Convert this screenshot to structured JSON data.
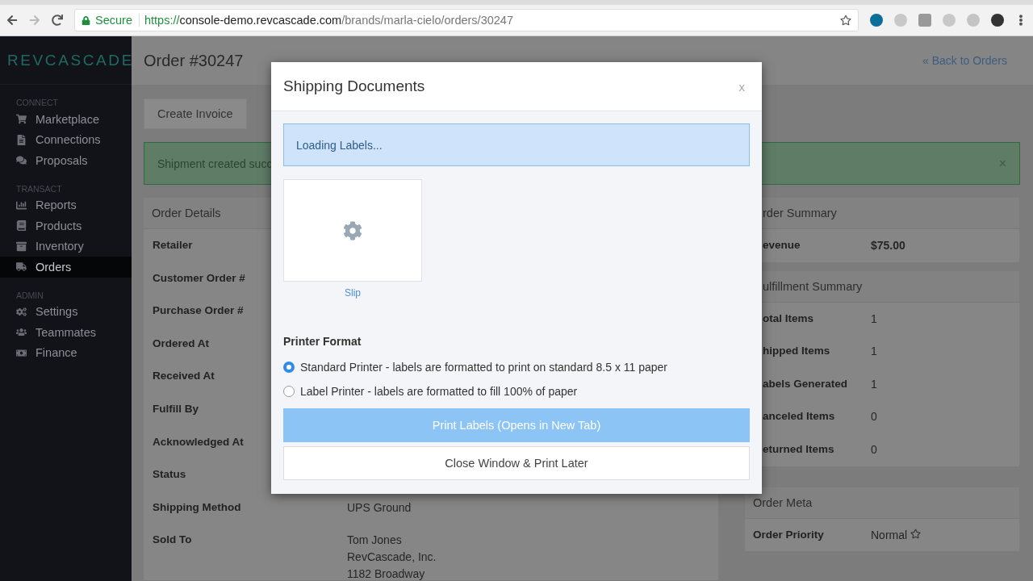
{
  "browser": {
    "secure_label": "Secure",
    "url_scheme": "https://",
    "url_host": "console-demo.revcascade.com",
    "url_path": "/brands/marla-cielo/orders/30247"
  },
  "sidebar": {
    "logo": "REVCASCADE",
    "sections": [
      {
        "title": "CONNECT",
        "items": [
          {
            "label": "Marketplace",
            "selected": false
          },
          {
            "label": "Connections",
            "selected": false
          },
          {
            "label": "Proposals",
            "selected": false
          }
        ]
      },
      {
        "title": "TRANSACT",
        "items": [
          {
            "label": "Reports",
            "selected": false
          },
          {
            "label": "Products",
            "selected": false
          },
          {
            "label": "Inventory",
            "selected": false
          },
          {
            "label": "Orders",
            "selected": true
          }
        ]
      },
      {
        "title": "ADMIN",
        "items": [
          {
            "label": "Settings",
            "selected": false
          },
          {
            "label": "Teammates",
            "selected": false
          },
          {
            "label": "Finance",
            "selected": false
          }
        ]
      }
    ]
  },
  "page": {
    "title": "Order #30247",
    "back_link": "« Back to Orders",
    "actions": [
      "Create Invoice"
    ],
    "alert": {
      "text": "Shipment created succ",
      "close": "×"
    },
    "order_details": {
      "title": "Order Details",
      "rows": [
        {
          "label": "Retailer"
        },
        {
          "label": "Customer Order #"
        },
        {
          "label": "Purchase Order #"
        },
        {
          "label": "Ordered At"
        },
        {
          "label": "Received At"
        },
        {
          "label": "Fulfill By"
        },
        {
          "label": "Acknowledged At"
        },
        {
          "label": "Status"
        },
        {
          "label": "Shipping Method",
          "value": [
            "UPS Ground"
          ]
        },
        {
          "label": "Sold To",
          "value": [
            "Tom Jones",
            "RevCascade, Inc.",
            "1182 Broadway"
          ]
        }
      ]
    },
    "summary_cards": [
      {
        "title": "rder Summary",
        "rows": [
          {
            "label": "evenue",
            "value": "$75.00",
            "bold": true
          }
        ]
      },
      {
        "title": "ulfillment Summary",
        "rows": [
          {
            "label": "otal Items",
            "value": "1",
            "bold": false
          },
          {
            "label": "hipped Items",
            "value": "1",
            "bold": false
          },
          {
            "label": "abels Generated",
            "value": "1",
            "bold": false
          },
          {
            "label": "anceled Items",
            "value": "0",
            "bold": false
          },
          {
            "label": "eturned Items",
            "value": "0",
            "bold": false
          }
        ]
      },
      {
        "title": "Order Meta",
        "rows": [
          {
            "label": "Order Priority",
            "value": "Normal",
            "bold": false,
            "starred": false
          }
        ]
      }
    ]
  },
  "modal": {
    "title": "Shipping Documents",
    "close": "x",
    "notice": "Loading Labels...",
    "documents": [
      {
        "label": "Slip"
      }
    ],
    "printer_format": {
      "title": "Printer Format",
      "options": [
        {
          "label": "Standard Printer - labels are formatted to print on standard 8.5 x 11 paper",
          "selected": true
        },
        {
          "label": "Label Printer - labels are formatted to fill 100% of paper",
          "selected": false
        }
      ]
    },
    "primary_button": {
      "label": "Print Labels (Opens in New Tab)",
      "disabled": true
    },
    "secondary_button": {
      "label": "Close Window & Print Later"
    }
  }
}
